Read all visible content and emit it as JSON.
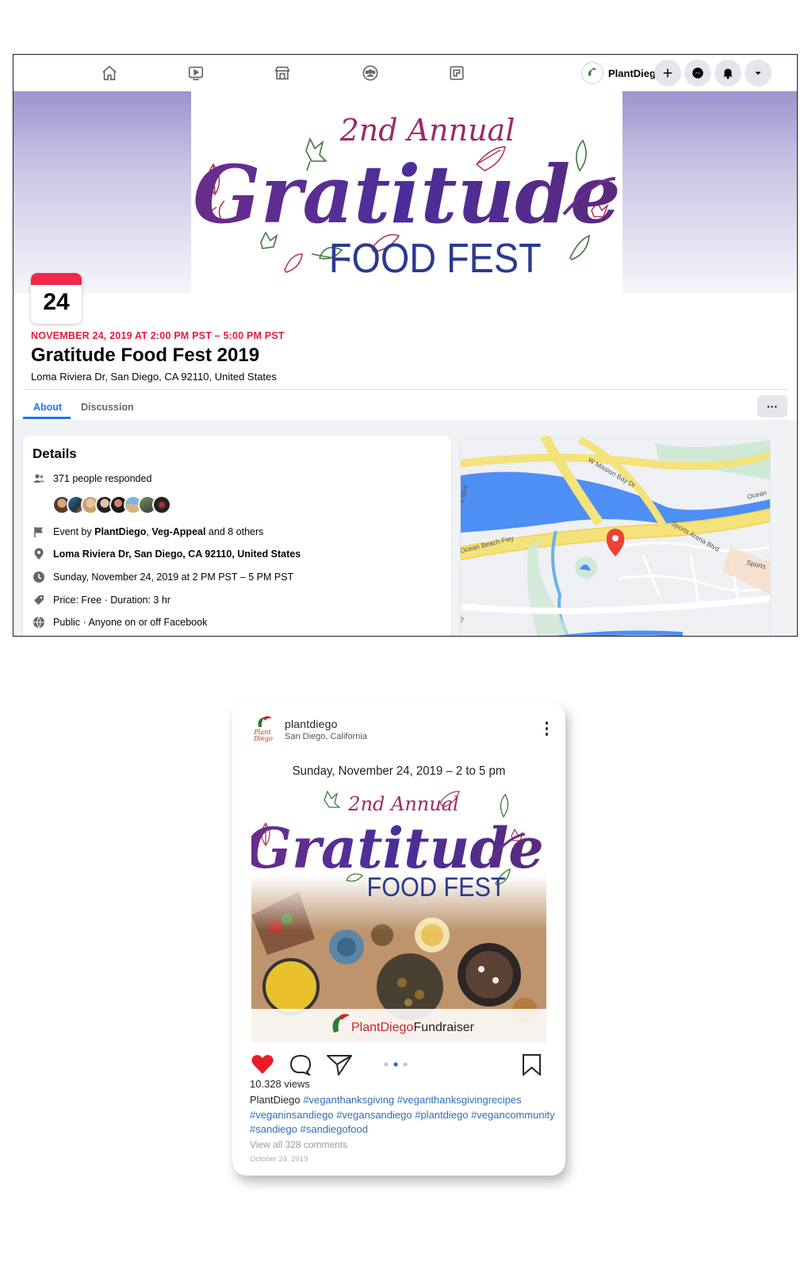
{
  "facebook": {
    "nav": {
      "icons": [
        "home-icon",
        "watch-icon",
        "marketplace-icon",
        "groups-icon",
        "gaming-icon"
      ],
      "profile_name": "PlantDiego",
      "actions": [
        "plus-icon",
        "messenger-icon",
        "bell-icon",
        "caret-down-icon"
      ]
    },
    "cover": {
      "line1": "2nd Annual",
      "line2": "Gratitude",
      "line3": "FOOD FEST"
    },
    "event": {
      "calendar_day": "24",
      "date_line": "NOVEMBER 24, 2019 AT 2:00 PM PST – 5:00 PM PST",
      "title": "Gratitude Food Fest 2019",
      "location": "Loma Riviera Dr, San Diego, CA 92110, United States"
    },
    "tabs": [
      {
        "label": "About",
        "active": true
      },
      {
        "label": "Discussion",
        "active": false
      }
    ],
    "more_label": "···",
    "details": {
      "heading": "Details",
      "responded": "371 people responded",
      "event_by_prefix": "Event by ",
      "event_by_host1": "PlantDiego",
      "event_by_sep": ", ",
      "event_by_host2": "Veg-Appeal",
      "event_by_suffix": " and 8 others",
      "address": "Loma Riviera Dr, San Diego, CA 92110, United States",
      "datetime": "Sunday, November 24, 2019 at 2 PM PST – 5 PM PST",
      "price": "Price: Free · Duration: 3 hr",
      "privacy": "Public · Anyone on or off Facebook"
    },
    "map_labels": {
      "road1": "W Mission Bay Dr",
      "road2": "Sports Arena Blvd",
      "road3": "Ocean Beach Fwy",
      "road4": "Ocean",
      "road5": "Sports",
      "road6": "s Blvd",
      "road7": "rd"
    }
  },
  "instagram": {
    "username": "plantdiego",
    "location": "San Diego, California",
    "logo_text1": "Plant",
    "logo_text2": "Diego",
    "post": {
      "top_line": "Sunday, November 24, 2019 – 2 to 5 pm",
      "line1": "2nd Annual",
      "line2": "Gratitude",
      "line3": "FOOD FEST",
      "fundraiser_brand": "PlantDiego",
      "fundraiser_word": " Fundraiser"
    },
    "views": "10.328 views",
    "caption_user": "PlantDiego",
    "hashtags": [
      "#veganthanksgiving",
      "#veganthanksgivingrecipes",
      "#veganinsandiego",
      "#vegansandiego",
      "#plantdiego",
      "#vegancommunity",
      "#sandiego",
      "#sandiegofood"
    ],
    "view_comments": "View all 328 comments",
    "date": "October 24, 2019",
    "liked": true,
    "carousel_active_index": 1,
    "carousel_count": 3
  },
  "colors": {
    "fb_blue": "#1877f2",
    "fb_red": "#e41e3f",
    "purple_title": "#5b2d8c",
    "magenta": "#9b2a6b",
    "navy": "#2a3a8f",
    "hashtag_blue": "#2f6fb8",
    "heart_red": "#ed1c24"
  }
}
